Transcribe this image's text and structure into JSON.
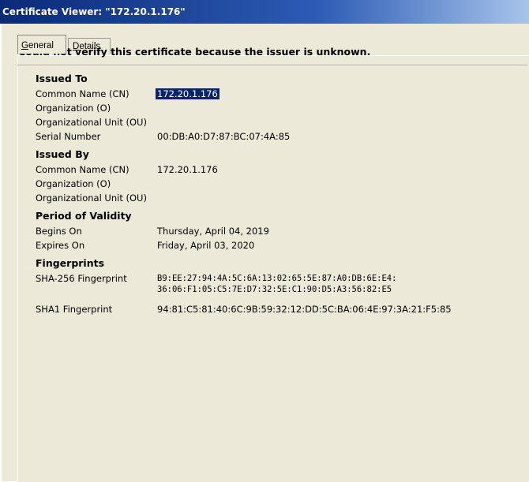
{
  "window": {
    "title": "Certificate Viewer: \"172.20.1.176\""
  },
  "tabs": {
    "general": {
      "prefix": "",
      "accel": "G",
      "rest": "eneral"
    },
    "details": {
      "prefix": "",
      "accel": "D",
      "rest": "etails"
    }
  },
  "warning": "Could not verify this certificate because the issuer is unknown.",
  "issued_to": {
    "title": "Issued To",
    "cn_label": "Common Name (CN)",
    "cn_value": "172.20.1.176",
    "org_label": "Organization (O)",
    "ou_label": "Organizational Unit (OU)",
    "serial_label": "Serial Number",
    "serial_value": "00:DB:A0:D7:87:BC:07:4A:85"
  },
  "issued_by": {
    "title": "Issued By",
    "cn_label": "Common Name (CN)",
    "cn_value": "172.20.1.176",
    "org_label": "Organization (O)",
    "ou_label": "Organizational Unit (OU)"
  },
  "validity": {
    "title": "Period of Validity",
    "begins_label": "Begins On",
    "begins_value": "Thursday, April 04, 2019",
    "expires_label": "Expires On",
    "expires_value": "Friday, April 03, 2020"
  },
  "fingerprints": {
    "title": "Fingerprints",
    "sha256_label": "SHA-256 Fingerprint",
    "sha256_line1": "B9:EE:27:94:4A:5C:6A:13:02:65:5E:87:A0:DB:6E:E4:",
    "sha256_line2": "36:06:F1:05:C5:7E:D7:32:5E:C1:90:D5:A3:56:82:E5",
    "sha1_label": "SHA1 Fingerprint",
    "sha1_value": "94:81:C5:81:40:6C:9B:59:32:12:DD:5C:BA:06:4E:97:3A:21:F5:85"
  }
}
